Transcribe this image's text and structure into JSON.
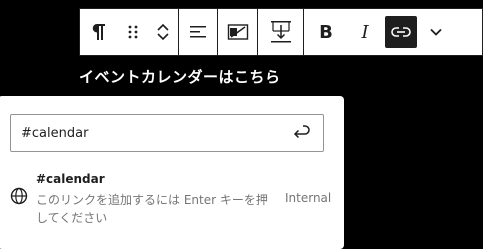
{
  "block_heading": "イベントカレンダーはこちら",
  "toolbar": {
    "paragraph_label": "Paragraph",
    "drag_label": "Drag",
    "move_label": "Move up/down",
    "align_label": "Align",
    "wrap_label": "Wrap",
    "height_label": "Height",
    "bold_label": "Bold",
    "italic_label": "Italic",
    "link_label": "Link",
    "more_label": "More"
  },
  "link_popover": {
    "input_value": "#calendar",
    "submit_label": "Submit",
    "suggestion": {
      "title": "#calendar",
      "description": "このリンクを追加するには Enter キーを押してください",
      "type": "Internal"
    }
  },
  "colors": {
    "background": "#000000",
    "toolbar": "#ffffff",
    "active_button": "#1e1e1e",
    "muted_text": "#757575"
  }
}
